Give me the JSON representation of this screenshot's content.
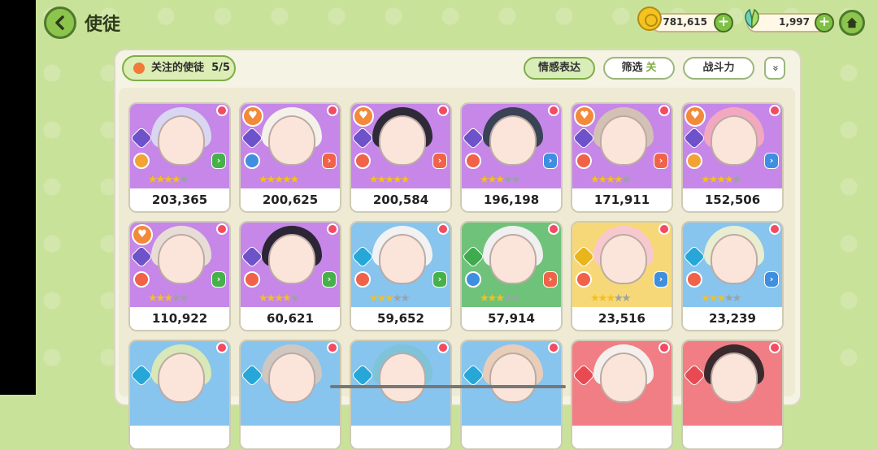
{
  "header": {
    "title": "使徒"
  },
  "currency": {
    "gold": "781,615",
    "gems": "1,997",
    "plus": "+"
  },
  "toolbar": {
    "favorite_label": "关注的使徒",
    "favorite_count": "5/5",
    "emotion_label": "情感表达",
    "filter_label": "筛选",
    "filter_state": "关",
    "power_label": "战斗力",
    "expand_symbol": "»"
  },
  "cards": [
    {
      "power": "203,365",
      "stars": 4,
      "color": "purple",
      "hair": "#d9d6f2",
      "favorite": false,
      "element": "#6d52c9",
      "role": "#f2a334",
      "atk": "#46b14a"
    },
    {
      "power": "200,625",
      "stars": 5,
      "color": "purple",
      "hair": "#f4f1ea",
      "favorite": true,
      "element": "#6d52c9",
      "role": "#3f8ee0",
      "atk": "#f06348"
    },
    {
      "power": "200,584",
      "stars": 5,
      "color": "purple",
      "hair": "#2f2a38",
      "favorite": true,
      "element": "#6d52c9",
      "role": "#f06348",
      "atk": "#f06348"
    },
    {
      "power": "196,198",
      "stars": 3,
      "color": "purple",
      "hair": "#3a4256",
      "favorite": false,
      "element": "#6d52c9",
      "role": "#f06348",
      "atk": "#3f8ee0"
    },
    {
      "power": "171,911",
      "stars": 4,
      "color": "purple",
      "hair": "#d3c1b5",
      "favorite": true,
      "element": "#6d52c9",
      "role": "#f06348",
      "atk": "#f06348"
    },
    {
      "power": "152,506",
      "stars": 4,
      "color": "purple",
      "hair": "#f2a9bf",
      "favorite": true,
      "element": "#6d52c9",
      "role": "#f2a334",
      "atk": "#3f8ee0"
    },
    {
      "power": "110,922",
      "stars": 3,
      "color": "purple",
      "hair": "#e8ddd6",
      "favorite": true,
      "element": "#6d52c9",
      "role": "#f06348",
      "atk": "#46b14a"
    },
    {
      "power": "60,621",
      "stars": 4,
      "color": "purple",
      "hair": "#2b2536",
      "favorite": false,
      "element": "#6d52c9",
      "role": "#f06348",
      "atk": "#46b14a"
    },
    {
      "power": "59,652",
      "stars": 3,
      "color": "blue",
      "hair": "#f2f2f2",
      "favorite": false,
      "element": "#27a7d8",
      "role": "#f06348",
      "atk": "#46b14a"
    },
    {
      "power": "57,914",
      "stars": 3,
      "color": "green",
      "hair": "#f0f0f0",
      "favorite": false,
      "element": "#3fab4d",
      "role": "#3f8ee0",
      "atk": "#f06348"
    },
    {
      "power": "23,516",
      "stars": 3,
      "color": "yellow",
      "hair": "#f7c9cf",
      "favorite": false,
      "element": "#e8b51a",
      "role": "#f06348",
      "atk": "#3f8ee0"
    },
    {
      "power": "23,239",
      "stars": 3,
      "color": "blue",
      "hair": "#e9edd1",
      "favorite": false,
      "element": "#27a7d8",
      "role": "#f06348",
      "atk": "#3f8ee0"
    },
    {
      "power": "",
      "stars": 0,
      "color": "blue",
      "hair": "#d8e8b8",
      "favorite": false,
      "element": "#27a7d8",
      "role": "",
      "atk": ""
    },
    {
      "power": "",
      "stars": 0,
      "color": "blue",
      "hair": "#cfc7c2",
      "favorite": false,
      "element": "#27a7d8",
      "role": "",
      "atk": ""
    },
    {
      "power": "",
      "stars": 0,
      "color": "blue",
      "hair": "#7ec3d8",
      "favorite": false,
      "element": "#27a7d8",
      "role": "",
      "atk": ""
    },
    {
      "power": "",
      "stars": 0,
      "color": "blue",
      "hair": "#e8cdb9",
      "favorite": false,
      "element": "#27a7d8",
      "role": "",
      "atk": ""
    },
    {
      "power": "",
      "stars": 0,
      "color": "red",
      "hair": "#f4f0ee",
      "favorite": false,
      "element": "#e84a52",
      "role": "",
      "atk": ""
    },
    {
      "power": "",
      "stars": 0,
      "color": "red",
      "hair": "#3a2a2e",
      "favorite": false,
      "element": "#e84a52",
      "role": "",
      "atk": ""
    }
  ]
}
